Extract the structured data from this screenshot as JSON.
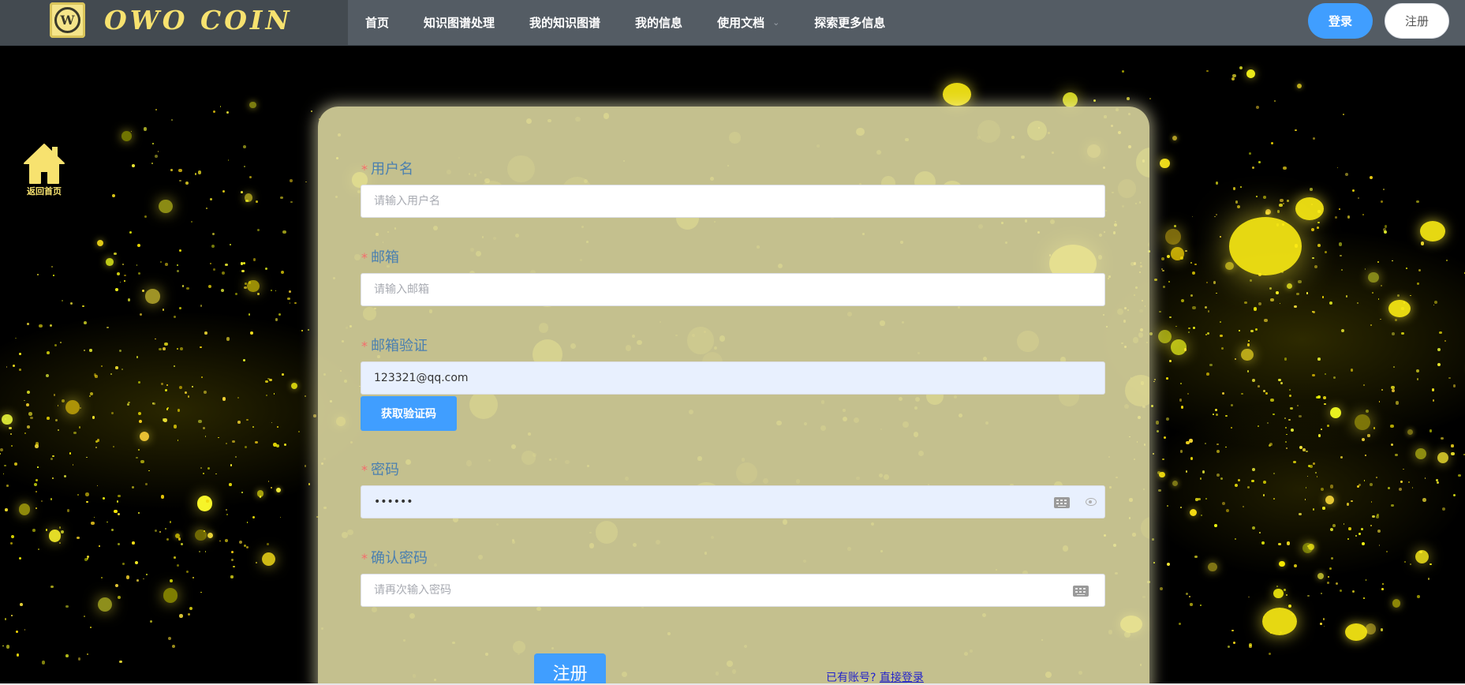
{
  "brand": {
    "name": "OWO COIN",
    "logo_letter": "W"
  },
  "nav": {
    "items": [
      {
        "label": "首页"
      },
      {
        "label": "知识图谱处理"
      },
      {
        "label": "我的知识图谱"
      },
      {
        "label": "我的信息"
      },
      {
        "label": "使用文档",
        "has_dropdown": true
      },
      {
        "label": "探索更多信息"
      }
    ],
    "login_label": "登录",
    "register_label": "注册"
  },
  "home_link": {
    "label": "返回首页",
    "icon": "home-icon"
  },
  "form": {
    "username": {
      "label": "用户名",
      "placeholder": "请输入用户名",
      "value": ""
    },
    "email": {
      "label": "邮箱",
      "placeholder": "请输入邮箱",
      "value": ""
    },
    "email_verify": {
      "label": "邮箱验证",
      "value": "123321@qq.com",
      "button_label": "获取验证码"
    },
    "password": {
      "label": "密码",
      "value": "••••••"
    },
    "confirm_password": {
      "label": "确认密码",
      "placeholder": "请再次输入密码",
      "value": ""
    },
    "required_mark": "*",
    "submit_label": "注册",
    "login_prompt": "已有账号?",
    "login_link": "直接登录"
  },
  "colors": {
    "nav_bg": "#545c64",
    "primary": "#409eff",
    "brand_yellow": "#f7e26f",
    "card_bg": "#e4e0a5",
    "label_blue": "#4a7fb0",
    "required_red": "#f56c6c"
  }
}
